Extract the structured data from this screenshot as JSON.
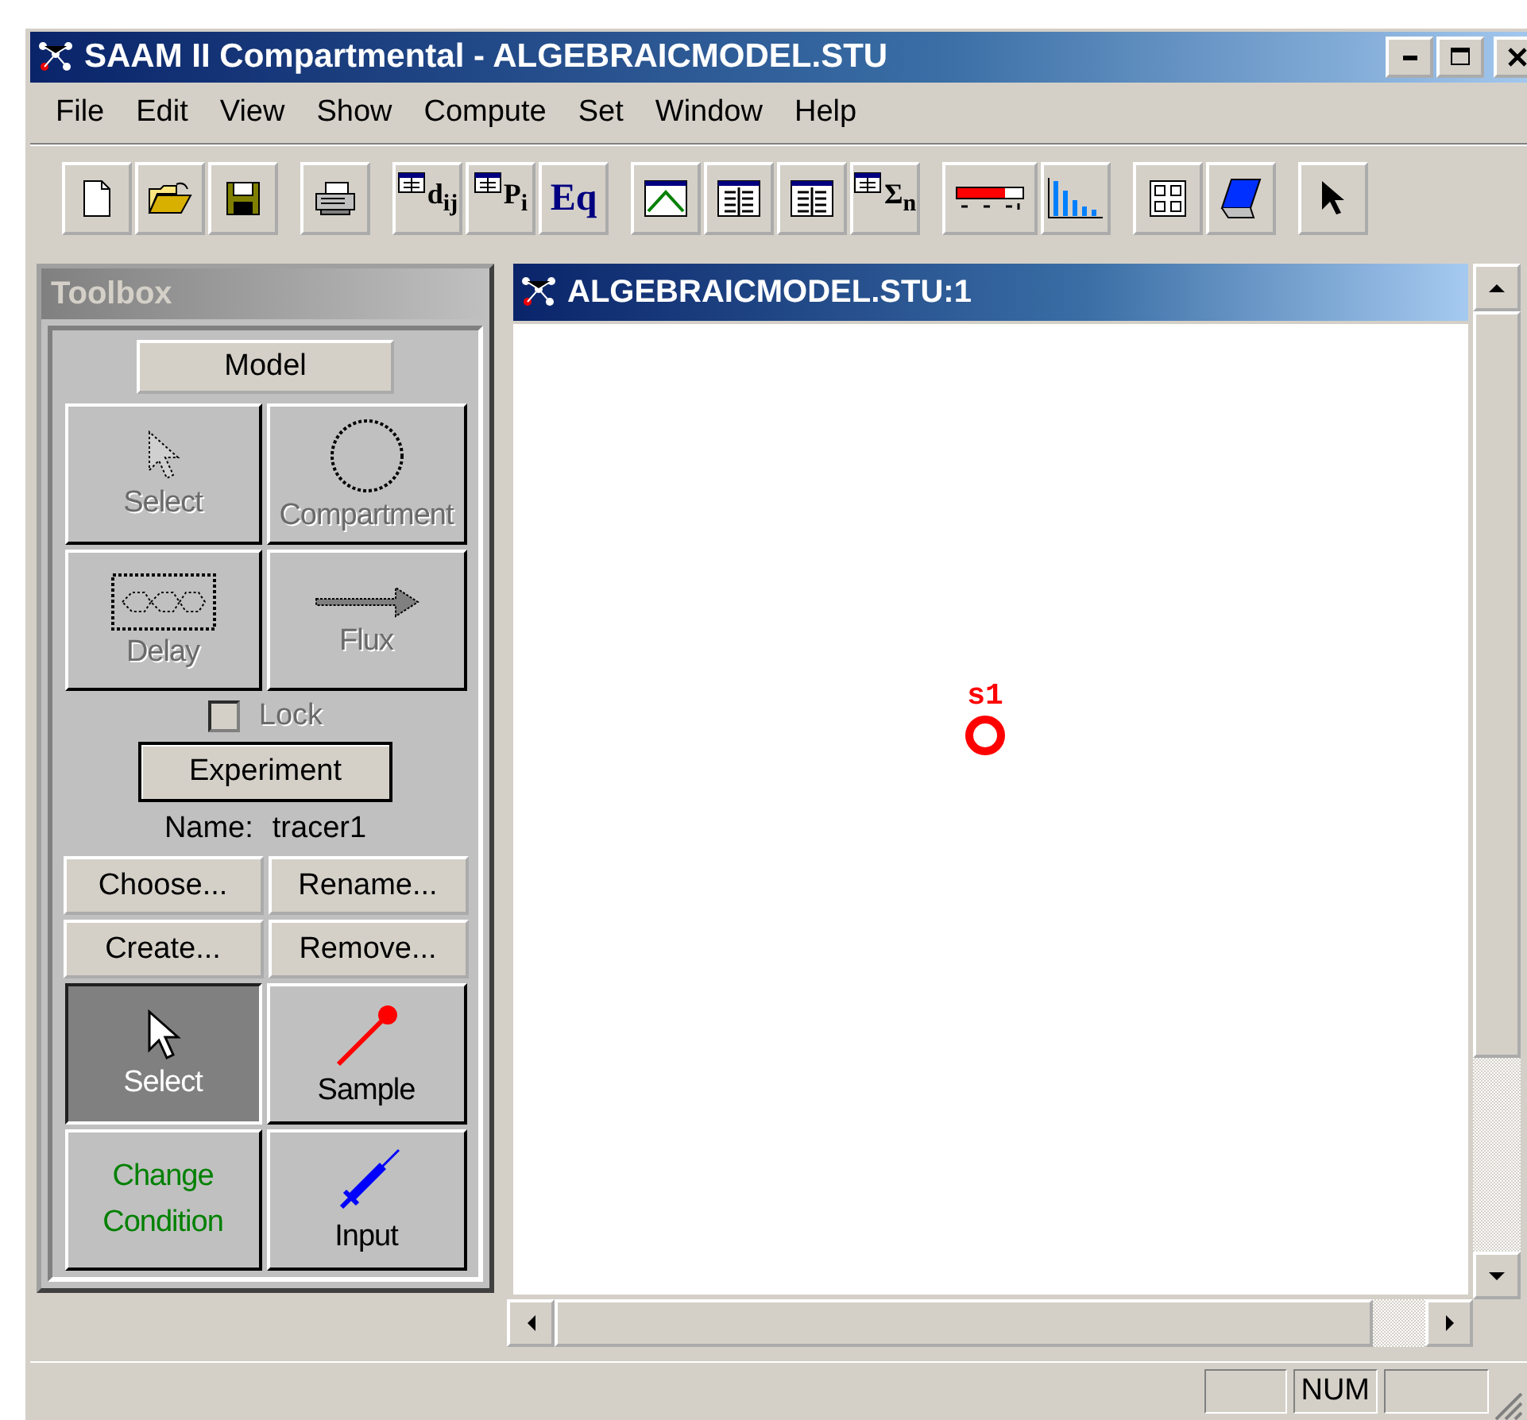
{
  "window": {
    "title": "SAAM II Compartmental - ALGEBRAICMODEL.STU"
  },
  "menu": [
    {
      "label": "File"
    },
    {
      "label": "Edit"
    },
    {
      "label": "View"
    },
    {
      "label": "Show"
    },
    {
      "label": "Compute"
    },
    {
      "label": "Set"
    },
    {
      "label": "Window"
    },
    {
      "label": "Help"
    }
  ],
  "toolbar": [
    [
      {
        "kind": "new"
      },
      {
        "kind": "open"
      },
      {
        "kind": "save"
      }
    ],
    [
      {
        "kind": "print"
      }
    ],
    [
      {
        "kind": "table",
        "label": "d$_{ij}$"
      },
      {
        "kind": "table",
        "label": "P$_{i}$"
      },
      {
        "kind": "text",
        "label": "Eq"
      }
    ],
    [
      {
        "kind": "plot"
      },
      {
        "kind": "sheet"
      },
      {
        "kind": "sheet2"
      },
      {
        "kind": "table",
        "label": "Σ$_{n}$"
      }
    ],
    [
      {
        "kind": "progress"
      },
      {
        "kind": "histogram"
      }
    ],
    [
      {
        "kind": "grid"
      },
      {
        "kind": "notebook"
      }
    ],
    [
      {
        "kind": "pointer"
      }
    ]
  ],
  "toolbox": {
    "title": "Toolbox",
    "model_button": "Model",
    "model_tools": [
      {
        "kind": "select",
        "label": "Select",
        "disabled": true
      },
      {
        "kind": "compartment",
        "label": "Compartment",
        "disabled": true
      },
      {
        "kind": "delay",
        "label": "Delay",
        "disabled": true
      },
      {
        "kind": "flux",
        "label": "Flux",
        "disabled": true
      }
    ],
    "lock": {
      "label": "Lock",
      "checked": false,
      "disabled": true
    },
    "experiment_button": "Experiment",
    "name_label": "Name:",
    "name_value": "tracer1",
    "experiment_buttons": [
      "Choose...",
      "Rename...",
      "Create...",
      "Remove..."
    ],
    "experiment_tools": [
      {
        "kind": "select",
        "label": "Select",
        "selected": true
      },
      {
        "kind": "sample",
        "label": "Sample",
        "selected": false
      },
      {
        "kind": "condition",
        "label": "Change Condition",
        "selected": false
      },
      {
        "kind": "input",
        "label": "Input",
        "selected": false
      }
    ]
  },
  "document": {
    "title": "ALGEBRAICMODEL.STU:1",
    "nodes": [
      {
        "kind": "sample",
        "label": "s1"
      }
    ]
  },
  "status_bar": {
    "indicators": [
      "NUM"
    ]
  }
}
